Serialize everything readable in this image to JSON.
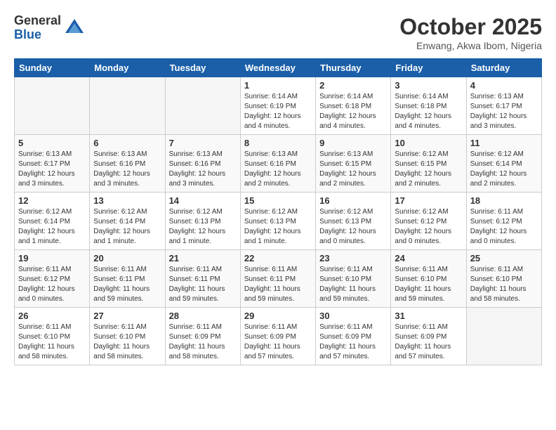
{
  "logo": {
    "general": "General",
    "blue": "Blue"
  },
  "title": "October 2025",
  "location": "Enwang, Akwa Ibom, Nigeria",
  "weekdays": [
    "Sunday",
    "Monday",
    "Tuesday",
    "Wednesday",
    "Thursday",
    "Friday",
    "Saturday"
  ],
  "weeks": [
    [
      {
        "day": "",
        "info": ""
      },
      {
        "day": "",
        "info": ""
      },
      {
        "day": "",
        "info": ""
      },
      {
        "day": "1",
        "info": "Sunrise: 6:14 AM\nSunset: 6:19 PM\nDaylight: 12 hours\nand 4 minutes."
      },
      {
        "day": "2",
        "info": "Sunrise: 6:14 AM\nSunset: 6:18 PM\nDaylight: 12 hours\nand 4 minutes."
      },
      {
        "day": "3",
        "info": "Sunrise: 6:14 AM\nSunset: 6:18 PM\nDaylight: 12 hours\nand 4 minutes."
      },
      {
        "day": "4",
        "info": "Sunrise: 6:13 AM\nSunset: 6:17 PM\nDaylight: 12 hours\nand 3 minutes."
      }
    ],
    [
      {
        "day": "5",
        "info": "Sunrise: 6:13 AM\nSunset: 6:17 PM\nDaylight: 12 hours\nand 3 minutes."
      },
      {
        "day": "6",
        "info": "Sunrise: 6:13 AM\nSunset: 6:16 PM\nDaylight: 12 hours\nand 3 minutes."
      },
      {
        "day": "7",
        "info": "Sunrise: 6:13 AM\nSunset: 6:16 PM\nDaylight: 12 hours\nand 3 minutes."
      },
      {
        "day": "8",
        "info": "Sunrise: 6:13 AM\nSunset: 6:16 PM\nDaylight: 12 hours\nand 2 minutes."
      },
      {
        "day": "9",
        "info": "Sunrise: 6:13 AM\nSunset: 6:15 PM\nDaylight: 12 hours\nand 2 minutes."
      },
      {
        "day": "10",
        "info": "Sunrise: 6:12 AM\nSunset: 6:15 PM\nDaylight: 12 hours\nand 2 minutes."
      },
      {
        "day": "11",
        "info": "Sunrise: 6:12 AM\nSunset: 6:14 PM\nDaylight: 12 hours\nand 2 minutes."
      }
    ],
    [
      {
        "day": "12",
        "info": "Sunrise: 6:12 AM\nSunset: 6:14 PM\nDaylight: 12 hours\nand 1 minute."
      },
      {
        "day": "13",
        "info": "Sunrise: 6:12 AM\nSunset: 6:14 PM\nDaylight: 12 hours\nand 1 minute."
      },
      {
        "day": "14",
        "info": "Sunrise: 6:12 AM\nSunset: 6:13 PM\nDaylight: 12 hours\nand 1 minute."
      },
      {
        "day": "15",
        "info": "Sunrise: 6:12 AM\nSunset: 6:13 PM\nDaylight: 12 hours\nand 1 minute."
      },
      {
        "day": "16",
        "info": "Sunrise: 6:12 AM\nSunset: 6:13 PM\nDaylight: 12 hours\nand 0 minutes."
      },
      {
        "day": "17",
        "info": "Sunrise: 6:12 AM\nSunset: 6:12 PM\nDaylight: 12 hours\nand 0 minutes."
      },
      {
        "day": "18",
        "info": "Sunrise: 6:11 AM\nSunset: 6:12 PM\nDaylight: 12 hours\nand 0 minutes."
      }
    ],
    [
      {
        "day": "19",
        "info": "Sunrise: 6:11 AM\nSunset: 6:12 PM\nDaylight: 12 hours\nand 0 minutes."
      },
      {
        "day": "20",
        "info": "Sunrise: 6:11 AM\nSunset: 6:11 PM\nDaylight: 11 hours\nand 59 minutes."
      },
      {
        "day": "21",
        "info": "Sunrise: 6:11 AM\nSunset: 6:11 PM\nDaylight: 11 hours\nand 59 minutes."
      },
      {
        "day": "22",
        "info": "Sunrise: 6:11 AM\nSunset: 6:11 PM\nDaylight: 11 hours\nand 59 minutes."
      },
      {
        "day": "23",
        "info": "Sunrise: 6:11 AM\nSunset: 6:10 PM\nDaylight: 11 hours\nand 59 minutes."
      },
      {
        "day": "24",
        "info": "Sunrise: 6:11 AM\nSunset: 6:10 PM\nDaylight: 11 hours\nand 59 minutes."
      },
      {
        "day": "25",
        "info": "Sunrise: 6:11 AM\nSunset: 6:10 PM\nDaylight: 11 hours\nand 58 minutes."
      }
    ],
    [
      {
        "day": "26",
        "info": "Sunrise: 6:11 AM\nSunset: 6:10 PM\nDaylight: 11 hours\nand 58 minutes."
      },
      {
        "day": "27",
        "info": "Sunrise: 6:11 AM\nSunset: 6:10 PM\nDaylight: 11 hours\nand 58 minutes."
      },
      {
        "day": "28",
        "info": "Sunrise: 6:11 AM\nSunset: 6:09 PM\nDaylight: 11 hours\nand 58 minutes."
      },
      {
        "day": "29",
        "info": "Sunrise: 6:11 AM\nSunset: 6:09 PM\nDaylight: 11 hours\nand 57 minutes."
      },
      {
        "day": "30",
        "info": "Sunrise: 6:11 AM\nSunset: 6:09 PM\nDaylight: 11 hours\nand 57 minutes."
      },
      {
        "day": "31",
        "info": "Sunrise: 6:11 AM\nSunset: 6:09 PM\nDaylight: 11 hours\nand 57 minutes."
      },
      {
        "day": "",
        "info": ""
      }
    ]
  ]
}
